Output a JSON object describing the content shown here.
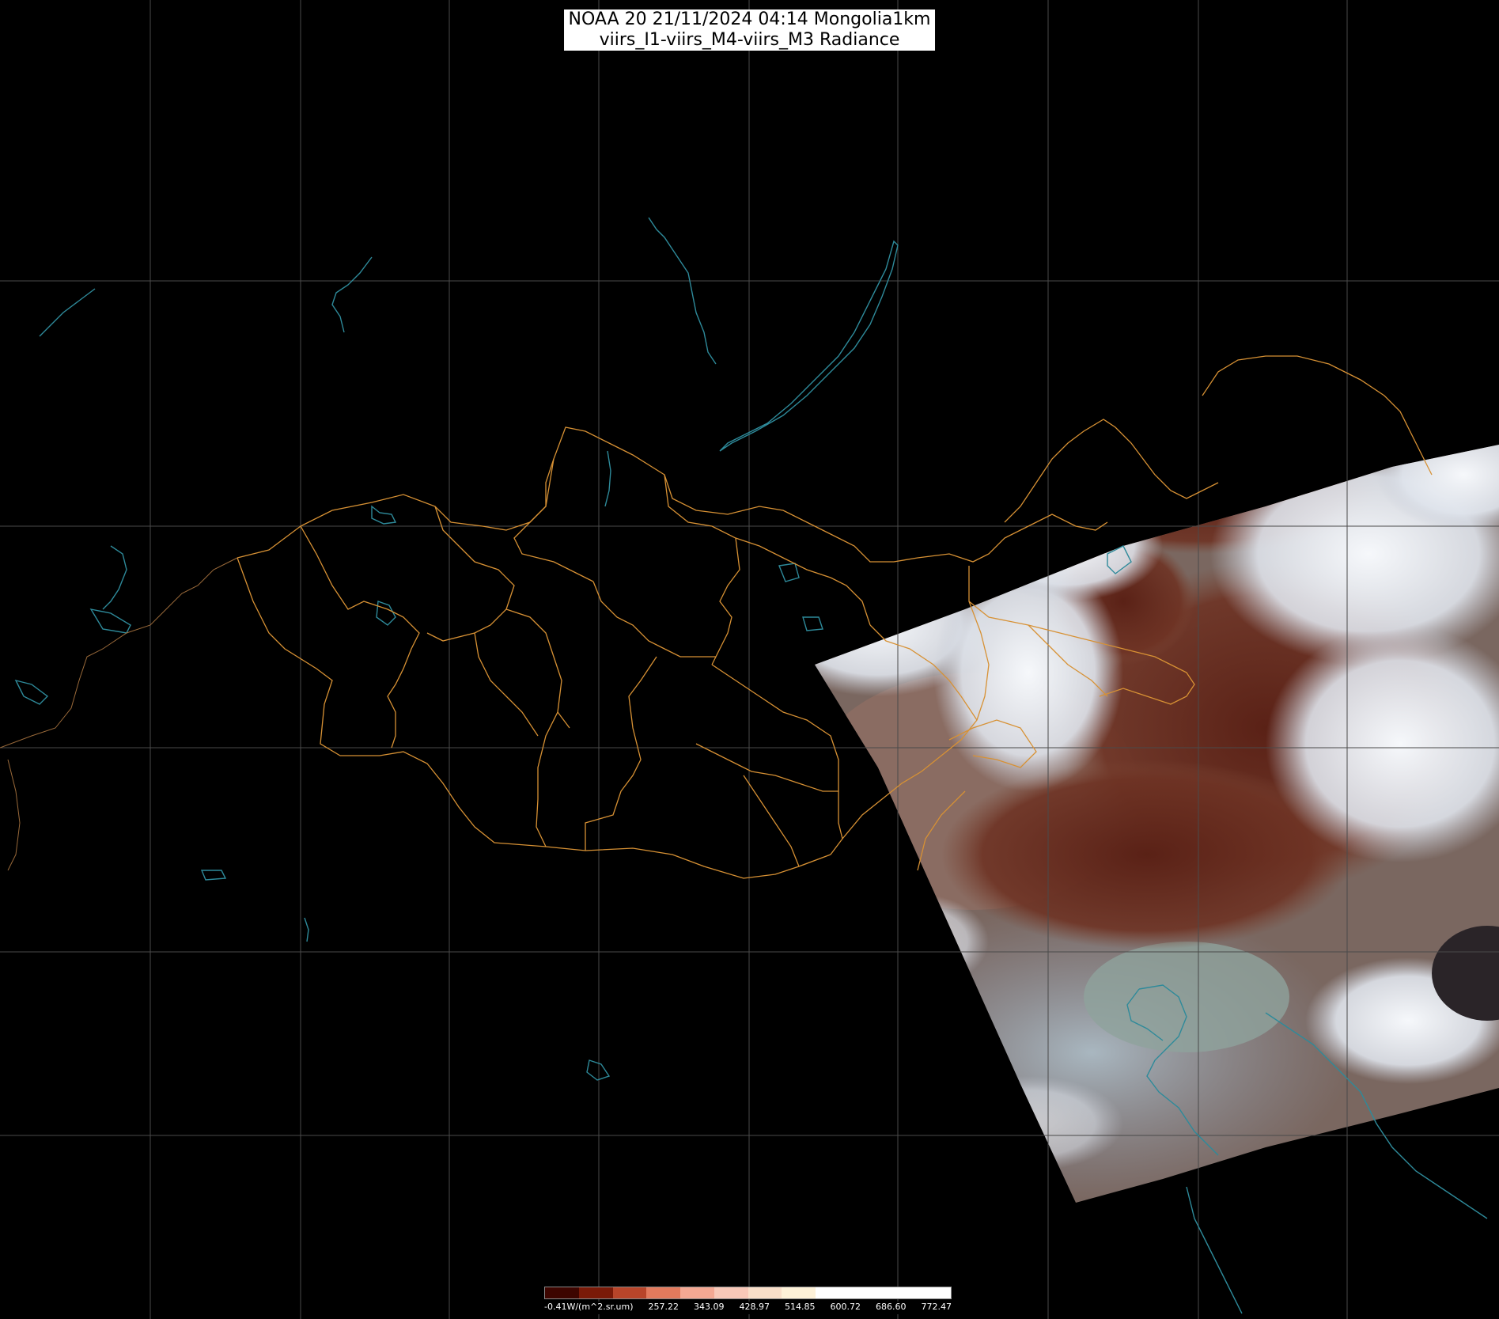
{
  "title": {
    "line1": "NOAA 20 21/11/2024 04:14 Mongolia1km",
    "line2": "viirs_I1-viirs_M4-viirs_M3 Radiance"
  },
  "legend": {
    "min_label": "-0.41W/(m^2.sr.um)",
    "tick_labels": [
      "257.22",
      "343.09",
      "428.97",
      "514.85",
      "600.72",
      "686.60",
      "772.47"
    ],
    "colors": [
      "#3d0500",
      "#7a1a08",
      "#b8452a",
      "#e27a5d",
      "#f4a893",
      "#f8c8b8",
      "#f9dfc9",
      "#fdf1d8",
      "#ffffff",
      "#ffffff",
      "#ffffff",
      "#ffffff"
    ]
  },
  "colors": {
    "background": "#000000",
    "graticule": "#4a4a4a",
    "borders": "#d79134",
    "water": "#2e8a9a",
    "cloud": "#e8ecf2",
    "land_brown": "#6b3422",
    "haze": "#8e9ba8"
  }
}
